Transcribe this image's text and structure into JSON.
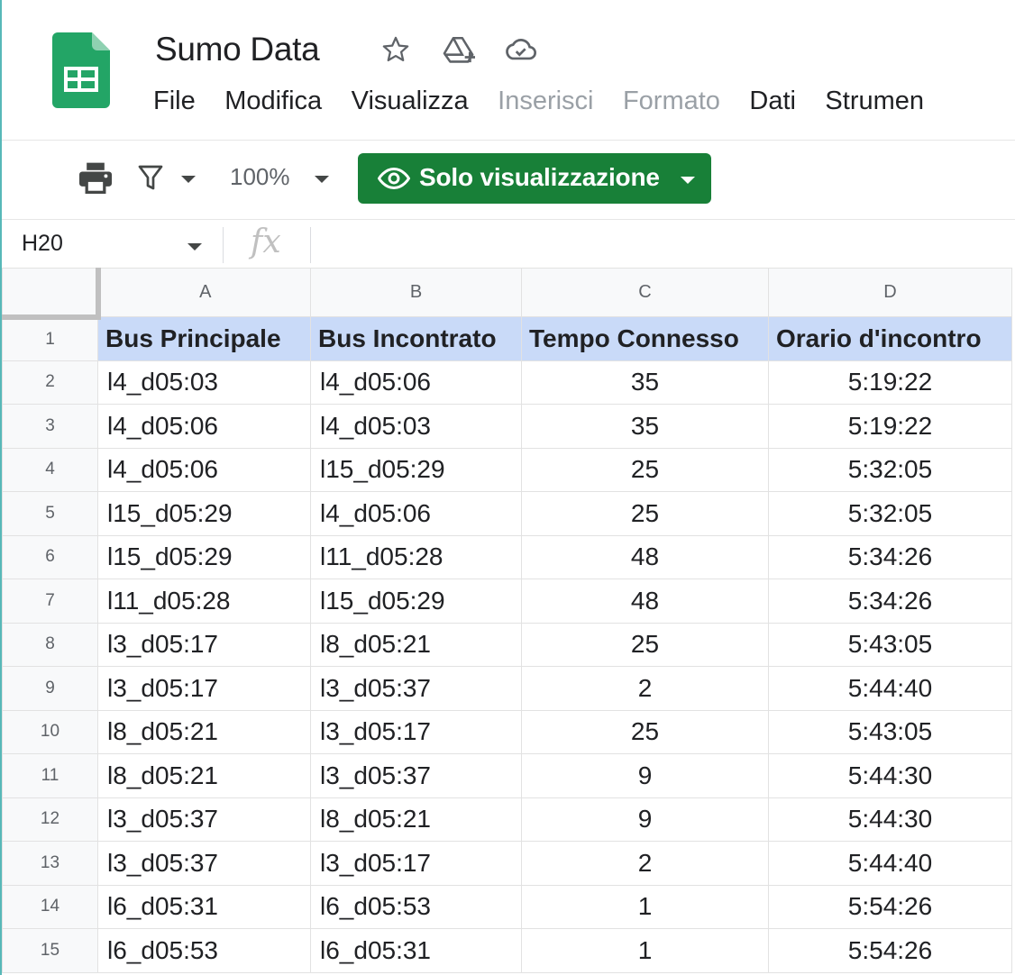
{
  "document": {
    "title": "Sumo Data"
  },
  "menu": [
    "File",
    "Modifica",
    "Visualizza",
    "Inserisci",
    "Formato",
    "Dati",
    "Strumen"
  ],
  "menu_disabled": [
    false,
    false,
    false,
    true,
    true,
    false,
    false
  ],
  "toolbar": {
    "zoom": "100%",
    "view_only_label": "Solo visualizzazione"
  },
  "formula_bar": {
    "cell_ref": "H20",
    "fx_label": "fx",
    "value": ""
  },
  "columns": [
    "A",
    "B",
    "C",
    "D"
  ],
  "rows": [
    {
      "n": "1",
      "cells": [
        "Bus Principale",
        "Bus Incontrato",
        "Tempo Connesso",
        "Orario d'incontro"
      ]
    },
    {
      "n": "2",
      "cells": [
        "l4_d05:03",
        "l4_d05:06",
        "35",
        "5:19:22"
      ]
    },
    {
      "n": "3",
      "cells": [
        "l4_d05:06",
        "l4_d05:03",
        "35",
        "5:19:22"
      ]
    },
    {
      "n": "4",
      "cells": [
        "l4_d05:06",
        "l15_d05:29",
        "25",
        "5:32:05"
      ]
    },
    {
      "n": "5",
      "cells": [
        "l15_d05:29",
        "l4_d05:06",
        "25",
        "5:32:05"
      ]
    },
    {
      "n": "6",
      "cells": [
        "l15_d05:29",
        "l11_d05:28",
        "48",
        "5:34:26"
      ]
    },
    {
      "n": "7",
      "cells": [
        "l11_d05:28",
        "l15_d05:29",
        "48",
        "5:34:26"
      ]
    },
    {
      "n": "8",
      "cells": [
        "l3_d05:17",
        "l8_d05:21",
        "25",
        "5:43:05"
      ]
    },
    {
      "n": "9",
      "cells": [
        "l3_d05:17",
        "l3_d05:37",
        "2",
        "5:44:40"
      ]
    },
    {
      "n": "10",
      "cells": [
        "l8_d05:21",
        "l3_d05:17",
        "25",
        "5:43:05"
      ]
    },
    {
      "n": "11",
      "cells": [
        "l8_d05:21",
        "l3_d05:37",
        "9",
        "5:44:30"
      ]
    },
    {
      "n": "12",
      "cells": [
        "l3_d05:37",
        "l8_d05:21",
        "9",
        "5:44:30"
      ]
    },
    {
      "n": "13",
      "cells": [
        "l3_d05:37",
        "l3_d05:17",
        "2",
        "5:44:40"
      ]
    },
    {
      "n": "14",
      "cells": [
        "l6_d05:31",
        "l6_d05:53",
        "1",
        "5:54:26"
      ]
    },
    {
      "n": "15",
      "cells": [
        "l6_d05:53",
        "l6_d05:31",
        "1",
        "5:54:26"
      ]
    }
  ],
  "colors": {
    "brand_green": "#188038",
    "header_row_fill": "#c9daf8",
    "sheets_icon": "#23a566"
  }
}
